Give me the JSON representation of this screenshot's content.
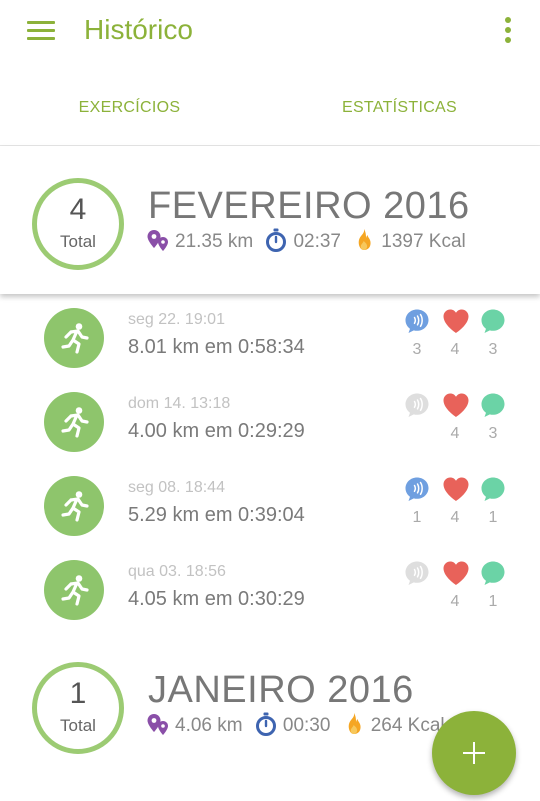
{
  "app_bar": {
    "title": "Histórico",
    "menu_icon": "hamburger-menu-icon",
    "overflow_icon": "more-vert-icon",
    "accent_color": "#8cb23a"
  },
  "tabs": [
    {
      "label": "EXERCÍCIOS",
      "selected": true
    },
    {
      "label": "ESTATÍSTICAS",
      "selected": false
    }
  ],
  "months": [
    {
      "title": "FEVEREIRO 2016",
      "total_count": "4",
      "total_label": "Total",
      "distance": "21.35 km",
      "duration": "02:37",
      "calories": "1397 Kcal",
      "exercises": [
        {
          "datetime": "seg 22. 19:01",
          "summary": "8.01 km em 0:58:34",
          "bumps": "3",
          "bumps_active": true,
          "likes": "4",
          "comments": "3"
        },
        {
          "datetime": "dom 14. 13:18",
          "summary": "4.00 km em 0:29:29",
          "bumps": "",
          "bumps_active": false,
          "likes": "4",
          "comments": "3"
        },
        {
          "datetime": "seg 08. 18:44",
          "summary": "5.29 km em 0:39:04",
          "bumps": "1",
          "bumps_active": true,
          "likes": "4",
          "comments": "1"
        },
        {
          "datetime": "qua 03. 18:56",
          "summary": "4.05 km em 0:30:29",
          "bumps": "",
          "bumps_active": false,
          "likes": "4",
          "comments": "1"
        }
      ]
    },
    {
      "title": "JANEIRO 2016",
      "total_count": "1",
      "total_label": "Total",
      "distance": "4.06 km",
      "duration": "00:30",
      "calories": "264 Kcal"
    }
  ],
  "icons": {
    "distance": "map-pin-distance-icon",
    "duration": "stopwatch-icon",
    "calories": "flame-icon",
    "exercise": "running-person-icon",
    "bump": "pep-talk-icon",
    "like": "heart-icon",
    "comment": "comment-bubble-icon",
    "fab": "plus-icon"
  },
  "colors": {
    "ring": "#9ccb73",
    "run_avatar": "#8ec56c",
    "bump_active": "#6f9fe0",
    "bump_inactive": "#dedede",
    "heart": "#e8625a",
    "comment": "#6bd3a6",
    "distance_icon": "#8a4fa8",
    "stopwatch_icon": "#3e64b0",
    "flame_icon": "#f5a623"
  }
}
